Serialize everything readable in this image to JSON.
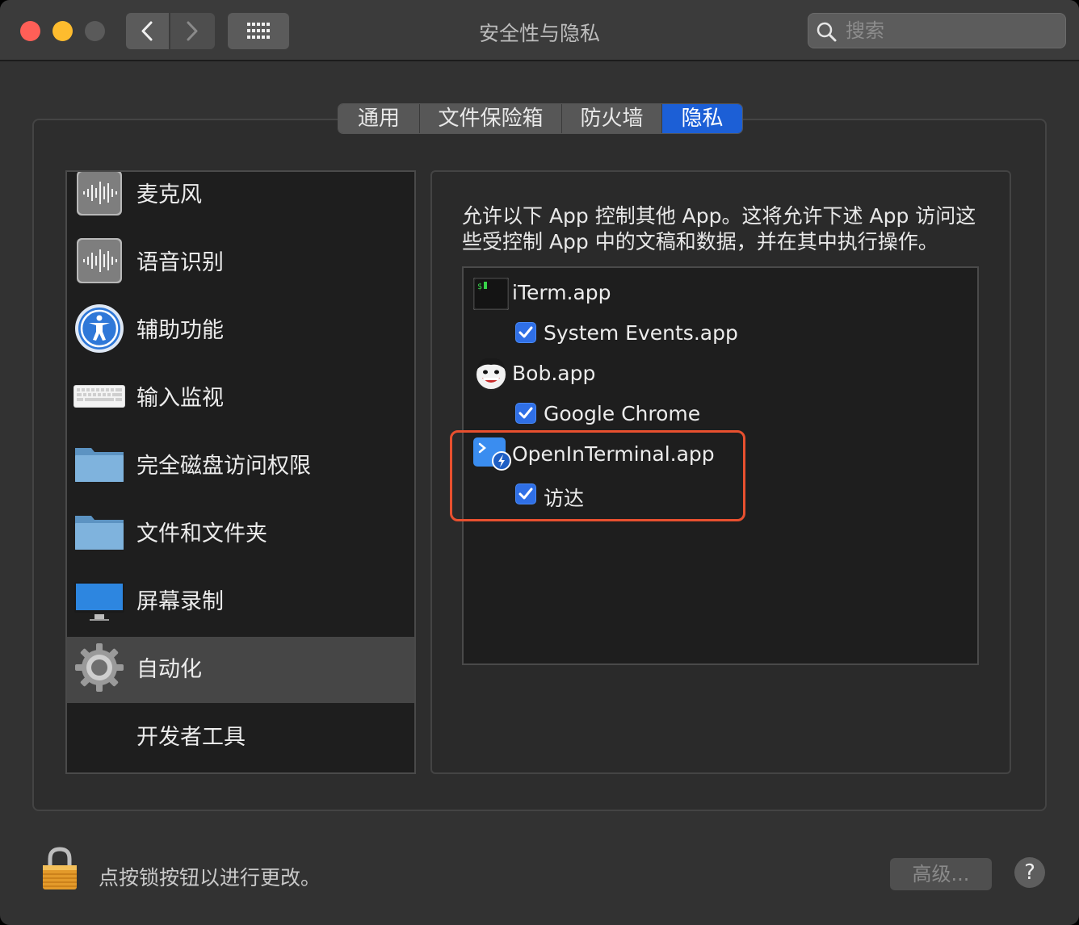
{
  "window": {
    "title": "安全性与隐私"
  },
  "search": {
    "placeholder": "搜索"
  },
  "tabs": [
    {
      "label": "通用",
      "selected": false
    },
    {
      "label": "文件保险箱",
      "selected": false
    },
    {
      "label": "防火墙",
      "selected": false
    },
    {
      "label": "隐私",
      "selected": true
    }
  ],
  "sidebar": {
    "items": [
      {
        "label": "麦克风",
        "icon": "microphone-icon"
      },
      {
        "label": "语音识别",
        "icon": "speech-recognition-icon"
      },
      {
        "label": "辅助功能",
        "icon": "accessibility-icon"
      },
      {
        "label": "输入监视",
        "icon": "keyboard-icon"
      },
      {
        "label": "完全磁盘访问权限",
        "icon": "folder-icon"
      },
      {
        "label": "文件和文件夹",
        "icon": "folder-icon"
      },
      {
        "label": "屏幕录制",
        "icon": "display-icon"
      },
      {
        "label": "自动化",
        "icon": "gear-icon",
        "selected": true
      },
      {
        "label": "开发者工具",
        "icon": ""
      }
    ]
  },
  "main": {
    "description": "允许以下 App 控制其他 App。这将允许下述 App 访问这些受控制 App 中的文稿和数据，并在其中执行操作。",
    "apps": [
      {
        "name": "iTerm.app",
        "icon": "iterm-icon",
        "target": "System Events.app",
        "checked": true
      },
      {
        "name": "Bob.app",
        "icon": "bob-icon",
        "target": "Google Chrome",
        "checked": true
      },
      {
        "name": "OpenInTerminal.app",
        "icon": "openinterminal-icon",
        "target": "访达",
        "checked": true
      }
    ]
  },
  "footer": {
    "lock_text": "点按锁按钮以进行更改。",
    "advanced_label": "高级...",
    "help_label": "?"
  },
  "colors": {
    "accent": "#1c5fd6",
    "highlight": "#e8502f"
  }
}
